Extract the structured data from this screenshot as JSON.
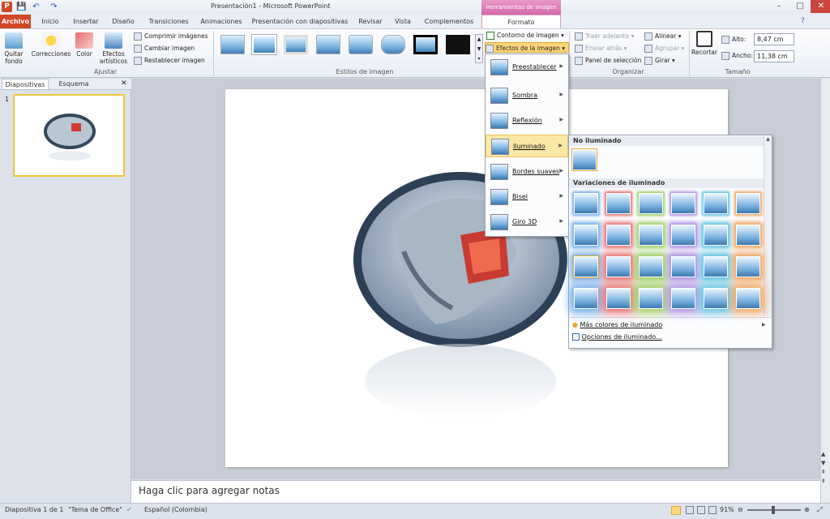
{
  "titlebar": {
    "title": "Presentación1  -  Microsoft PowerPoint",
    "context_header": "Herramientas de imagen"
  },
  "tabs": [
    "Archivo",
    "Inicio",
    "Insertar",
    "Diseño",
    "Transiciones",
    "Animaciones",
    "Presentación con diapositivas",
    "Revisar",
    "Vista",
    "Complementos",
    "Formato"
  ],
  "ribbon": {
    "ajustar": {
      "label": "Ajustar",
      "quitar_fondo": "Quitar fondo",
      "correcciones": "Correcciones",
      "color": "Color",
      "efectos": "Efectos artísticos",
      "comprimir": "Comprimir imágenes",
      "cambiar": "Cambiar imagen",
      "restablecer": "Restablecer imagen"
    },
    "estilos": {
      "label": "Estilos de imagen",
      "contorno": "Contorno de imagen",
      "efectos": "Efectos de la imagen"
    },
    "organizar": {
      "label": "Organizar",
      "traer": "Traer adelante",
      "enviar": "Enviar atrás",
      "panel": "Panel de selección",
      "alinear": "Alinear",
      "agrupar": "Agrupar",
      "girar": "Girar"
    },
    "tamano": {
      "label": "Tamaño",
      "recortar": "Recortar",
      "alto_label": "Alto:",
      "alto": "8,47 cm",
      "ancho_label": "Ancho:",
      "ancho": "11,38 cm"
    }
  },
  "pane": {
    "tab1": "Diapositivas",
    "tab2": "Esquema",
    "slide_num": "1"
  },
  "menu": {
    "items": [
      "Preestablecer",
      "Sombra",
      "Reflexión",
      "Iluminado",
      "Bordes suaves",
      "Bisel",
      "Giro 3D"
    ]
  },
  "submenu": {
    "no_glow": "No iluminado",
    "variations": "Variaciones de iluminado",
    "more_colors": "Más colores de iluminado",
    "options": "Opciones de iluminado..."
  },
  "notes": "Haga clic para agregar notas",
  "status": {
    "slide": "Diapositiva 1 de 1",
    "theme": "\"Tema de Office\"",
    "lang": "Español (Colombia)",
    "zoom": "91%"
  },
  "glow_colors": [
    "#6fa8e8",
    "#e86a6a",
    "#9acd5a",
    "#a98be0",
    "#5ac0e0",
    "#f0a05a"
  ]
}
